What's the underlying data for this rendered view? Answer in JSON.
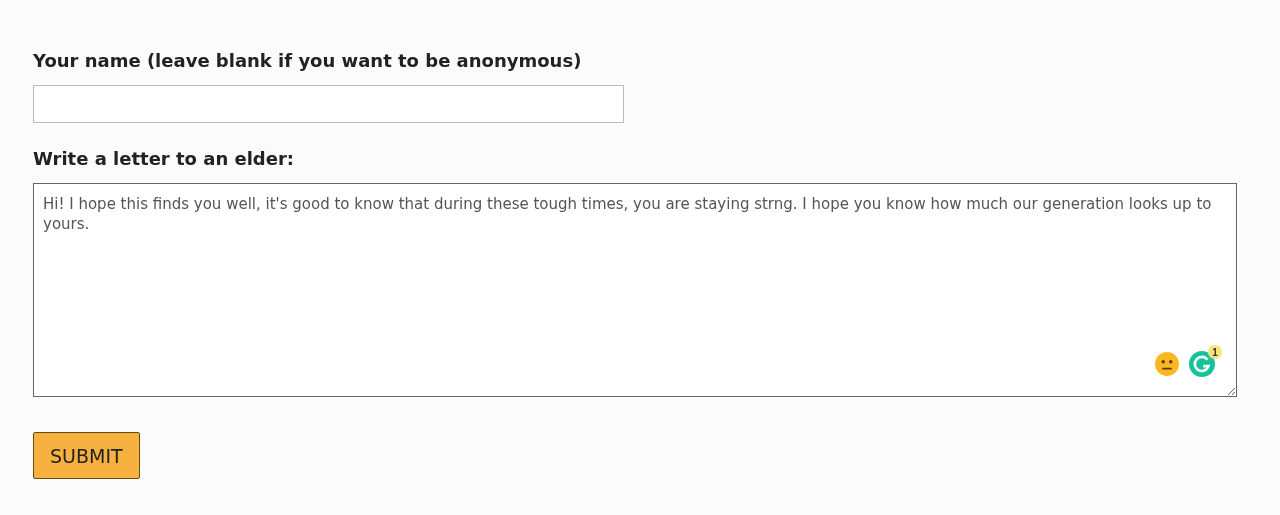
{
  "name_field": {
    "label": "Your name (leave blank if you want to be anonymous)"
  },
  "letter_field": {
    "label": "Write a letter to an elder:",
    "value": "Hi! I hope this finds you well, it's good to know that during these tough times, you are staying strng. I hope you know how much our generation looks up to yours."
  },
  "grammar_badge": "1",
  "submit_button": "SUBMIT"
}
